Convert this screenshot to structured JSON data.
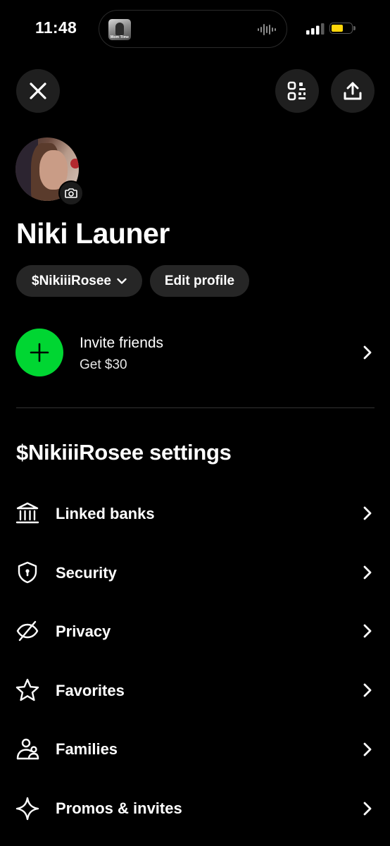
{
  "status_bar": {
    "time": "11:48",
    "now_playing_art_text": "Mom Time",
    "battery_level": 0.6
  },
  "top_actions": {
    "close_icon": "close-icon",
    "qr_icon": "qr-scan-icon",
    "share_icon": "share-icon"
  },
  "profile": {
    "name": "Niki Launer",
    "cashtag_label": "$NikiiiRosee",
    "edit_label": "Edit profile"
  },
  "invite": {
    "title": "Invite friends",
    "subtitle": "Get $30",
    "accent_color": "#00d632"
  },
  "settings": {
    "title": "$NikiiiRosee settings",
    "items": [
      {
        "label": "Linked banks",
        "icon": "bank-icon"
      },
      {
        "label": "Security",
        "icon": "shield-icon"
      },
      {
        "label": "Privacy",
        "icon": "eye-off-icon"
      },
      {
        "label": "Favorites",
        "icon": "star-icon"
      },
      {
        "label": "Families",
        "icon": "family-icon"
      },
      {
        "label": "Promos & invites",
        "icon": "sparkle-icon"
      }
    ]
  }
}
